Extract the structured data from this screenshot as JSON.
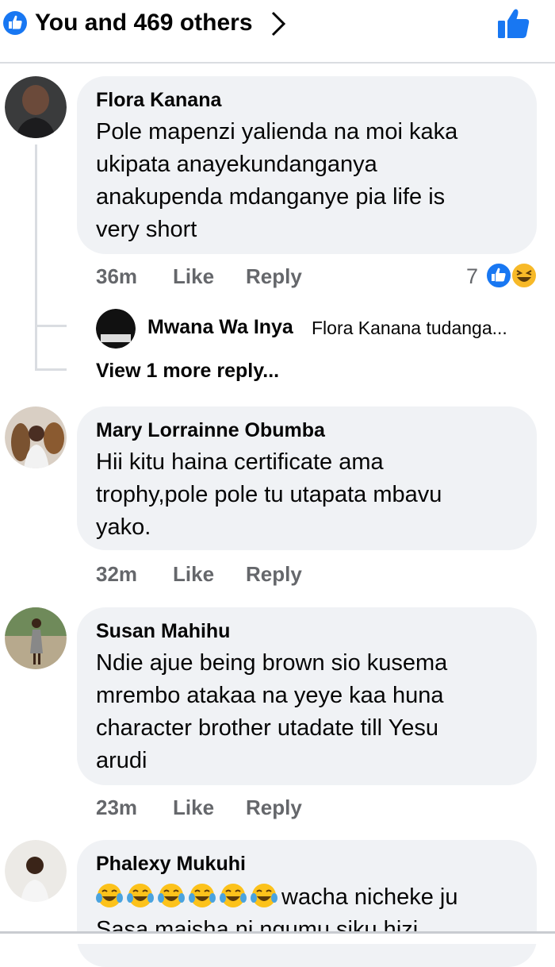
{
  "header": {
    "title": "You and 469 others",
    "icons": [
      "like-circle-icon",
      "chevron-right-icon",
      "thumbs-up-icon"
    ],
    "accent_color": "#1877f2"
  },
  "comments": [
    {
      "author": "Flora Kanana",
      "lines": [
        "Pole mapenzi yalienda na moi kaka",
        "ukipata anayekundanganya",
        "anakupenda mdanganye pia life is",
        "very short"
      ],
      "time": "36m",
      "like_label": "Like",
      "reply_label": "Reply",
      "reaction_count": "7",
      "reactions": [
        "like-icon",
        "haha-icon"
      ],
      "reply_preview": {
        "author": "Mwana Wa Inya",
        "snippet": "Flora Kanana tudanga..."
      },
      "view_more": "View 1 more reply..."
    },
    {
      "author": "Mary Lorrainne Obumba",
      "lines": [
        "Hii kitu haina certificate ama",
        "trophy,pole pole tu utapata mbavu",
        "yako."
      ],
      "time": "32m",
      "like_label": "Like",
      "reply_label": "Reply"
    },
    {
      "author": "Susan Mahihu",
      "lines": [
        "Ndie ajue being brown sio kusema",
        "mrembo atakaa na yeye kaa huna",
        "character brother utadate till Yesu",
        "arudi"
      ],
      "time": "23m",
      "like_label": "Like",
      "reply_label": "Reply"
    },
    {
      "author": "Phalexy Mukuhi",
      "emoji_count": 6,
      "emoji": "tears-of-joy-icon",
      "line1_text": "wacha nicheke ju",
      "line2": "Sasa maisha ni ngumu siku hizi"
    }
  ]
}
